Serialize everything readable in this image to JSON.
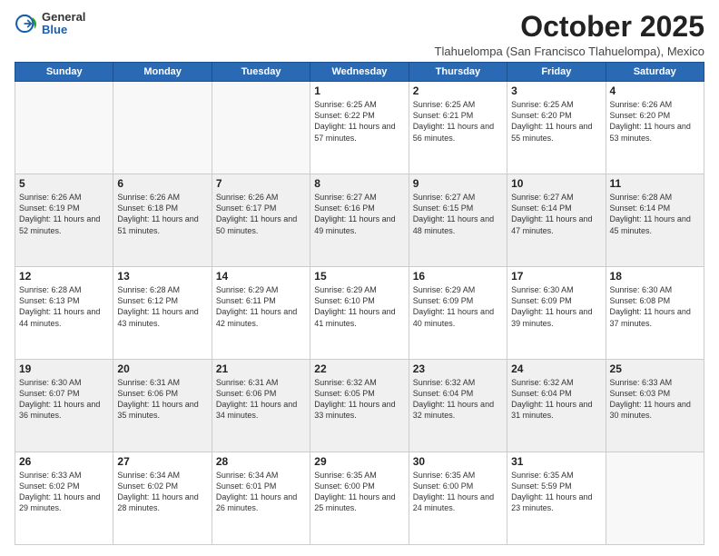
{
  "logo": {
    "general": "General",
    "blue": "Blue"
  },
  "header": {
    "month": "October 2025",
    "subtitle": "Tlahuelompa (San Francisco Tlahuelompa), Mexico"
  },
  "weekdays": [
    "Sunday",
    "Monday",
    "Tuesday",
    "Wednesday",
    "Thursday",
    "Friday",
    "Saturday"
  ],
  "weeks": [
    [
      {
        "day": "",
        "empty": true
      },
      {
        "day": "",
        "empty": true
      },
      {
        "day": "",
        "empty": true
      },
      {
        "day": "1",
        "sunrise": "6:25 AM",
        "sunset": "6:22 PM",
        "daylight": "11 hours and 57 minutes."
      },
      {
        "day": "2",
        "sunrise": "6:25 AM",
        "sunset": "6:21 PM",
        "daylight": "11 hours and 56 minutes."
      },
      {
        "day": "3",
        "sunrise": "6:25 AM",
        "sunset": "6:20 PM",
        "daylight": "11 hours and 55 minutes."
      },
      {
        "day": "4",
        "sunrise": "6:26 AM",
        "sunset": "6:20 PM",
        "daylight": "11 hours and 53 minutes."
      }
    ],
    [
      {
        "day": "5",
        "sunrise": "6:26 AM",
        "sunset": "6:19 PM",
        "daylight": "11 hours and 52 minutes."
      },
      {
        "day": "6",
        "sunrise": "6:26 AM",
        "sunset": "6:18 PM",
        "daylight": "11 hours and 51 minutes."
      },
      {
        "day": "7",
        "sunrise": "6:26 AM",
        "sunset": "6:17 PM",
        "daylight": "11 hours and 50 minutes."
      },
      {
        "day": "8",
        "sunrise": "6:27 AM",
        "sunset": "6:16 PM",
        "daylight": "11 hours and 49 minutes."
      },
      {
        "day": "9",
        "sunrise": "6:27 AM",
        "sunset": "6:15 PM",
        "daylight": "11 hours and 48 minutes."
      },
      {
        "day": "10",
        "sunrise": "6:27 AM",
        "sunset": "6:14 PM",
        "daylight": "11 hours and 47 minutes."
      },
      {
        "day": "11",
        "sunrise": "6:28 AM",
        "sunset": "6:14 PM",
        "daylight": "11 hours and 45 minutes."
      }
    ],
    [
      {
        "day": "12",
        "sunrise": "6:28 AM",
        "sunset": "6:13 PM",
        "daylight": "11 hours and 44 minutes."
      },
      {
        "day": "13",
        "sunrise": "6:28 AM",
        "sunset": "6:12 PM",
        "daylight": "11 hours and 43 minutes."
      },
      {
        "day": "14",
        "sunrise": "6:29 AM",
        "sunset": "6:11 PM",
        "daylight": "11 hours and 42 minutes."
      },
      {
        "day": "15",
        "sunrise": "6:29 AM",
        "sunset": "6:10 PM",
        "daylight": "11 hours and 41 minutes."
      },
      {
        "day": "16",
        "sunrise": "6:29 AM",
        "sunset": "6:09 PM",
        "daylight": "11 hours and 40 minutes."
      },
      {
        "day": "17",
        "sunrise": "6:30 AM",
        "sunset": "6:09 PM",
        "daylight": "11 hours and 39 minutes."
      },
      {
        "day": "18",
        "sunrise": "6:30 AM",
        "sunset": "6:08 PM",
        "daylight": "11 hours and 37 minutes."
      }
    ],
    [
      {
        "day": "19",
        "sunrise": "6:30 AM",
        "sunset": "6:07 PM",
        "daylight": "11 hours and 36 minutes."
      },
      {
        "day": "20",
        "sunrise": "6:31 AM",
        "sunset": "6:06 PM",
        "daylight": "11 hours and 35 minutes."
      },
      {
        "day": "21",
        "sunrise": "6:31 AM",
        "sunset": "6:06 PM",
        "daylight": "11 hours and 34 minutes."
      },
      {
        "day": "22",
        "sunrise": "6:32 AM",
        "sunset": "6:05 PM",
        "daylight": "11 hours and 33 minutes."
      },
      {
        "day": "23",
        "sunrise": "6:32 AM",
        "sunset": "6:04 PM",
        "daylight": "11 hours and 32 minutes."
      },
      {
        "day": "24",
        "sunrise": "6:32 AM",
        "sunset": "6:04 PM",
        "daylight": "11 hours and 31 minutes."
      },
      {
        "day": "25",
        "sunrise": "6:33 AM",
        "sunset": "6:03 PM",
        "daylight": "11 hours and 30 minutes."
      }
    ],
    [
      {
        "day": "26",
        "sunrise": "6:33 AM",
        "sunset": "6:02 PM",
        "daylight": "11 hours and 29 minutes."
      },
      {
        "day": "27",
        "sunrise": "6:34 AM",
        "sunset": "6:02 PM",
        "daylight": "11 hours and 28 minutes."
      },
      {
        "day": "28",
        "sunrise": "6:34 AM",
        "sunset": "6:01 PM",
        "daylight": "11 hours and 26 minutes."
      },
      {
        "day": "29",
        "sunrise": "6:35 AM",
        "sunset": "6:00 PM",
        "daylight": "11 hours and 25 minutes."
      },
      {
        "day": "30",
        "sunrise": "6:35 AM",
        "sunset": "6:00 PM",
        "daylight": "11 hours and 24 minutes."
      },
      {
        "day": "31",
        "sunrise": "6:35 AM",
        "sunset": "5:59 PM",
        "daylight": "11 hours and 23 minutes."
      },
      {
        "day": "",
        "empty": true
      }
    ]
  ]
}
